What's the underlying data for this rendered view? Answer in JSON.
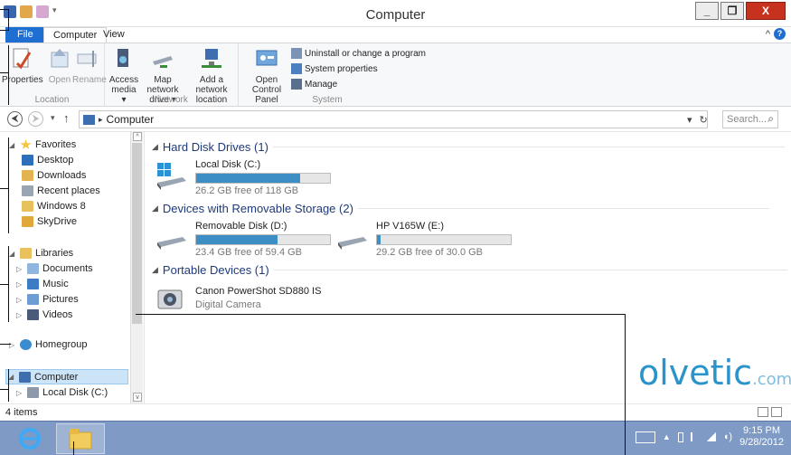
{
  "window": {
    "title": "Computer"
  },
  "quick_access": [
    "app-icon",
    "properties-icon",
    "new-folder-icon",
    "dropdown-icon"
  ],
  "window_controls": {
    "minimize": "_",
    "maximize": "❐",
    "close": "X"
  },
  "tabs": [
    {
      "label": "File"
    },
    {
      "label": "Computer"
    },
    {
      "label": "View"
    }
  ],
  "ribbon": {
    "groups": [
      {
        "label": "Location"
      },
      {
        "label": "Network"
      },
      {
        "label": "System"
      }
    ],
    "location": {
      "properties": "Properties",
      "open": "Open",
      "rename": "Rename"
    },
    "network": {
      "access_media_1": "Access",
      "access_media_2": "media ▾",
      "map_drive_1": "Map network",
      "map_drive_2": "drive ▾",
      "add_location_1": "Add a network",
      "add_location_2": "location"
    },
    "system": {
      "control_panel_1": "Open Control",
      "control_panel_2": "Panel",
      "uninstall": "Uninstall or change a program",
      "sysprops": "System properties",
      "manage": "Manage"
    }
  },
  "address": {
    "back": "⮜",
    "forward": "⮞",
    "recent": "▾",
    "up": "↑",
    "path_separator": "▸",
    "path": "Computer",
    "history": "▾",
    "refresh": "↻",
    "search_placeholder": "Search...",
    "search_glyph": "⌕"
  },
  "nav": {
    "favorites": "Favorites",
    "desktop": "Desktop",
    "downloads": "Downloads",
    "recent": "Recent places",
    "windows8": "Windows 8",
    "skydrive": "SkyDrive",
    "libraries": "Libraries",
    "documents": "Documents",
    "music": "Music",
    "pictures": "Pictures",
    "videos": "Videos",
    "homegroup": "Homegroup",
    "computer": "Computer",
    "localdisk": "Local Disk (C:)"
  },
  "content": {
    "hdd_group": "Hard Disk Drives (1)",
    "removable_group": "Devices with Removable Storage (2)",
    "portable_group": "Portable Devices (1)",
    "drives": [
      {
        "name": "Local Disk (C:)",
        "free": "26.2 GB free of 118 GB",
        "used_fraction": 0.78
      },
      {
        "name": "Removable Disk (D:)",
        "free": "23.4 GB free of 59.4 GB",
        "used_fraction": 0.61
      },
      {
        "name": "HP V165W (E:)",
        "free": "29.2 GB free of 30.0 GB",
        "used_fraction": 0.03
      }
    ],
    "device": {
      "name": "Canon PowerShot SD880 IS",
      "type": "Digital Camera"
    }
  },
  "status": {
    "items": "4 items"
  },
  "taskbar": {
    "time": "9:15 PM",
    "date": "9/28/2012"
  },
  "watermark": {
    "brand": "olvetic",
    "suffix": ".com"
  },
  "colors": {
    "accent": "#1f6ed1",
    "drive_fill": "#3c8ec4",
    "taskbar": "#7f9ac5",
    "heading": "#1e3a7a"
  }
}
